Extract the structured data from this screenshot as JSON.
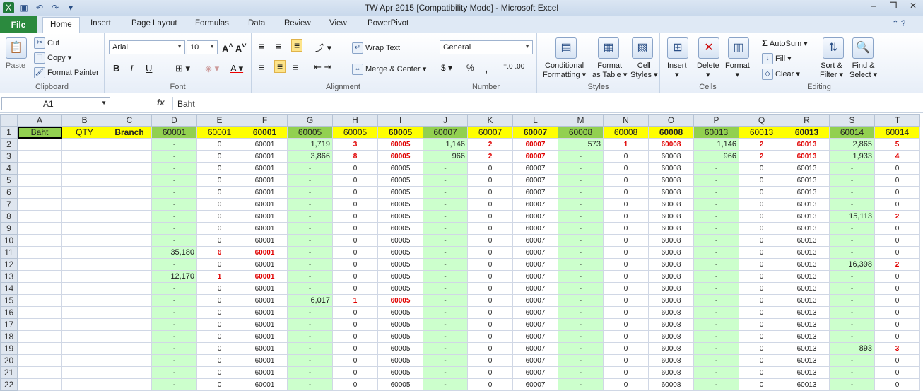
{
  "window": {
    "title": "TW Apr 2015  [Compatibility Mode]  -  Microsoft Excel"
  },
  "qat": [
    "save-icon",
    "undo-icon",
    "redo-icon",
    "customize-icon"
  ],
  "tabs": {
    "file": "File",
    "items": [
      "Home",
      "Insert",
      "Page Layout",
      "Formulas",
      "Data",
      "Review",
      "View",
      "PowerPivot"
    ],
    "active": "Home"
  },
  "ribbon": {
    "clipboard": {
      "label": "Clipboard",
      "paste": "Paste",
      "cut": "Cut",
      "copy": "Copy",
      "format_painter": "Format Painter"
    },
    "font": {
      "label": "Font",
      "name": "Arial",
      "size": "10",
      "bold": "B",
      "italic": "I",
      "underline": "U"
    },
    "alignment": {
      "label": "Alignment",
      "wrap": "Wrap Text",
      "merge": "Merge & Center"
    },
    "number": {
      "label": "Number",
      "format": "General",
      "percent": "%",
      "comma": ","
    },
    "styles": {
      "label": "Styles",
      "conditional": "Conditional",
      "conditional2": "Formatting",
      "format_as": "Format",
      "format_as2": "as Table",
      "cell": "Cell",
      "cell2": "Styles"
    },
    "cells": {
      "label": "Cells",
      "insert": "Insert",
      "delete": "Delete",
      "format": "Format"
    },
    "editing": {
      "label": "Editing",
      "autosum": "AutoSum",
      "fill": "Fill",
      "clear": "Clear",
      "sort": "Sort &",
      "sort2": "Filter",
      "find": "Find &",
      "find2": "Select"
    }
  },
  "formula_bar": {
    "name_box": "A1",
    "fx": "fx",
    "value": "Baht"
  },
  "columns": [
    "A",
    "B",
    "C",
    "D",
    "E",
    "F",
    "G",
    "H",
    "I",
    "J",
    "K",
    "L",
    "M",
    "N",
    "O",
    "P",
    "Q",
    "R",
    "S",
    "T"
  ],
  "header_row": [
    "Baht",
    "QTY",
    "Branch",
    "60001",
    "60001",
    "60001",
    "60005",
    "60005",
    "60005",
    "60007",
    "60007",
    "60007",
    "60008",
    "60008",
    "60008",
    "60013",
    "60013",
    "60013",
    "60014",
    "60014"
  ],
  "rows": [
    [
      "2",
      "-",
      "0",
      "60001",
      "1,719",
      "3",
      "60005",
      "1,146",
      "2",
      "60007",
      "573",
      "1",
      "60008",
      "1,146",
      "2",
      "60013",
      "2,865",
      "5"
    ],
    [
      "3",
      "-",
      "0",
      "60001",
      "3,866",
      "8",
      "60005",
      "966",
      "2",
      "60007",
      "-",
      "0",
      "60008",
      "966",
      "2",
      "60013",
      "1,933",
      "4"
    ],
    [
      "4",
      "-",
      "0",
      "60001",
      "-",
      "0",
      "60005",
      "-",
      "0",
      "60007",
      "-",
      "0",
      "60008",
      "-",
      "0",
      "60013",
      "-",
      "0"
    ],
    [
      "5",
      "-",
      "0",
      "60001",
      "-",
      "0",
      "60005",
      "-",
      "0",
      "60007",
      "-",
      "0",
      "60008",
      "-",
      "0",
      "60013",
      "-",
      "0"
    ],
    [
      "6",
      "-",
      "0",
      "60001",
      "-",
      "0",
      "60005",
      "-",
      "0",
      "60007",
      "-",
      "0",
      "60008",
      "-",
      "0",
      "60013",
      "-",
      "0"
    ],
    [
      "7",
      "-",
      "0",
      "60001",
      "-",
      "0",
      "60005",
      "-",
      "0",
      "60007",
      "-",
      "0",
      "60008",
      "-",
      "0",
      "60013",
      "-",
      "0"
    ],
    [
      "8",
      "-",
      "0",
      "60001",
      "-",
      "0",
      "60005",
      "-",
      "0",
      "60007",
      "-",
      "0",
      "60008",
      "-",
      "0",
      "60013",
      "15,113",
      "2"
    ],
    [
      "9",
      "-",
      "0",
      "60001",
      "-",
      "0",
      "60005",
      "-",
      "0",
      "60007",
      "-",
      "0",
      "60008",
      "-",
      "0",
      "60013",
      "-",
      "0"
    ],
    [
      "10",
      "-",
      "0",
      "60001",
      "-",
      "0",
      "60005",
      "-",
      "0",
      "60007",
      "-",
      "0",
      "60008",
      "-",
      "0",
      "60013",
      "-",
      "0"
    ],
    [
      "11",
      "35,180",
      "6",
      "60001",
      "-",
      "0",
      "60005",
      "-",
      "0",
      "60007",
      "-",
      "0",
      "60008",
      "-",
      "0",
      "60013",
      "-",
      "0"
    ],
    [
      "12",
      "-",
      "0",
      "60001",
      "-",
      "0",
      "60005",
      "-",
      "0",
      "60007",
      "-",
      "0",
      "60008",
      "-",
      "0",
      "60013",
      "16,398",
      "2"
    ],
    [
      "13",
      "12,170",
      "1",
      "60001",
      "-",
      "0",
      "60005",
      "-",
      "0",
      "60007",
      "-",
      "0",
      "60008",
      "-",
      "0",
      "60013",
      "-",
      "0"
    ],
    [
      "14",
      "-",
      "0",
      "60001",
      "-",
      "0",
      "60005",
      "-",
      "0",
      "60007",
      "-",
      "0",
      "60008",
      "-",
      "0",
      "60013",
      "-",
      "0"
    ],
    [
      "15",
      "-",
      "0",
      "60001",
      "6,017",
      "1",
      "60005",
      "-",
      "0",
      "60007",
      "-",
      "0",
      "60008",
      "-",
      "0",
      "60013",
      "-",
      "0"
    ],
    [
      "16",
      "-",
      "0",
      "60001",
      "-",
      "0",
      "60005",
      "-",
      "0",
      "60007",
      "-",
      "0",
      "60008",
      "-",
      "0",
      "60013",
      "-",
      "0"
    ],
    [
      "17",
      "-",
      "0",
      "60001",
      "-",
      "0",
      "60005",
      "-",
      "0",
      "60007",
      "-",
      "0",
      "60008",
      "-",
      "0",
      "60013",
      "-",
      "0"
    ],
    [
      "18",
      "-",
      "0",
      "60001",
      "-",
      "0",
      "60005",
      "-",
      "0",
      "60007",
      "-",
      "0",
      "60008",
      "-",
      "0",
      "60013",
      "-",
      "0"
    ],
    [
      "19",
      "-",
      "0",
      "60001",
      "-",
      "0",
      "60005",
      "-",
      "0",
      "60007",
      "-",
      "0",
      "60008",
      "-",
      "0",
      "60013",
      "893",
      "3"
    ],
    [
      "20",
      "-",
      "0",
      "60001",
      "-",
      "0",
      "60005",
      "-",
      "0",
      "60007",
      "-",
      "0",
      "60008",
      "-",
      "0",
      "60013",
      "-",
      "0"
    ],
    [
      "21",
      "-",
      "0",
      "60001",
      "-",
      "0",
      "60005",
      "-",
      "0",
      "60007",
      "-",
      "0",
      "60008",
      "-",
      "0",
      "60013",
      "-",
      "0"
    ],
    [
      "22",
      "-",
      "0",
      "60001",
      "-",
      "0",
      "60005",
      "-",
      "0",
      "60007",
      "-",
      "0",
      "60008",
      "-",
      "0",
      "60013",
      "-",
      "0"
    ]
  ],
  "colors": {
    "green_fill": "#ccffcc",
    "yellow_fill": "#ffff00",
    "header_green": "#92d050",
    "red_text": "#e00000"
  }
}
